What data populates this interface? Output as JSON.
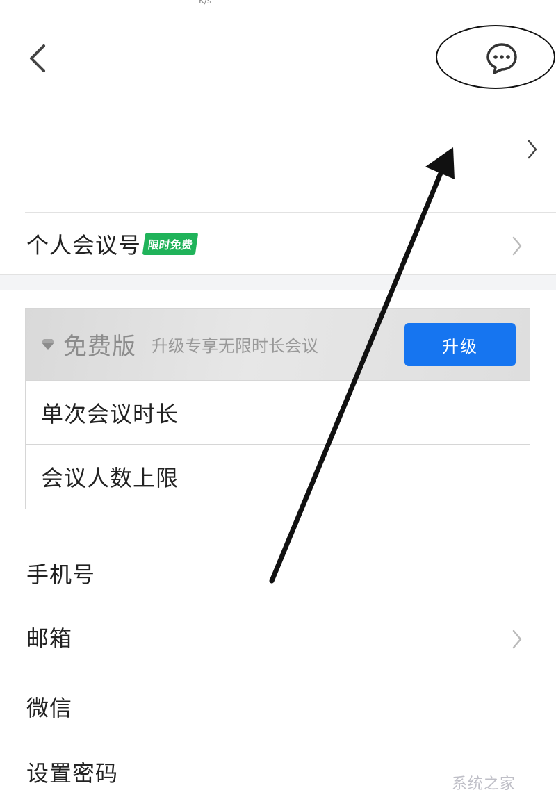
{
  "status_bar": {
    "speed_unit_fragment": "K/s"
  },
  "header": {
    "back_icon": "chevron-left-icon",
    "more_icon": "chat-bubble-ellipsis-icon"
  },
  "personal_meeting": {
    "label": "个人会议号",
    "tag": "限时免费"
  },
  "plan_card": {
    "plan_icon": "diamond-icon",
    "plan_name": "免费版",
    "plan_desc": "升级专享无限时长会议",
    "upgrade_label": "升级",
    "rows": [
      "单次会议时长",
      "会议人数上限"
    ]
  },
  "account": {
    "phone_label": "手机号",
    "email_label": "邮箱",
    "wechat_label": "微信",
    "password_label": "设置密码"
  },
  "watermark": "系统之家",
  "colors": {
    "accent_blue": "#1675f0",
    "tag_green": "#20b35a",
    "annotation": "#111111"
  }
}
